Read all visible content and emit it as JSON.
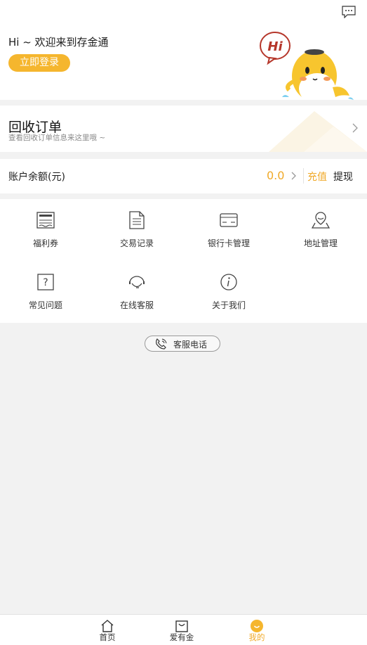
{
  "header": {
    "greeting": "Hi ~ 欢迎来到存金通",
    "login_label": "立即登录",
    "mascot_text": "Hi"
  },
  "order": {
    "title": "回收订单",
    "subtitle": "查看回收订单信息来这里哦 ~"
  },
  "balance": {
    "label": "账户余额(元)",
    "value": "0.0",
    "recharge_label": "充值",
    "withdraw_label": "提现"
  },
  "menu": {
    "items": [
      {
        "label": "福利券",
        "icon": "coupon-icon"
      },
      {
        "label": "交易记录",
        "icon": "document-icon"
      },
      {
        "label": "银行卡管理",
        "icon": "bank-card-icon"
      },
      {
        "label": "地址管理",
        "icon": "location-icon"
      },
      {
        "label": "常见问题",
        "icon": "question-icon"
      },
      {
        "label": "在线客服",
        "icon": "headset-icon"
      },
      {
        "label": "关于我们",
        "icon": "info-icon"
      }
    ]
  },
  "hotline": {
    "label": "客服电话"
  },
  "tabbar": {
    "tabs": [
      {
        "label": "首页",
        "icon": "home-icon"
      },
      {
        "label": "爱有金",
        "icon": "bag-icon"
      },
      {
        "label": "我的",
        "icon": "profile-icon",
        "active": true
      }
    ]
  },
  "colors": {
    "accent": "#f0a928",
    "button": "#f5b62e",
    "background": "#f2f2f2"
  }
}
